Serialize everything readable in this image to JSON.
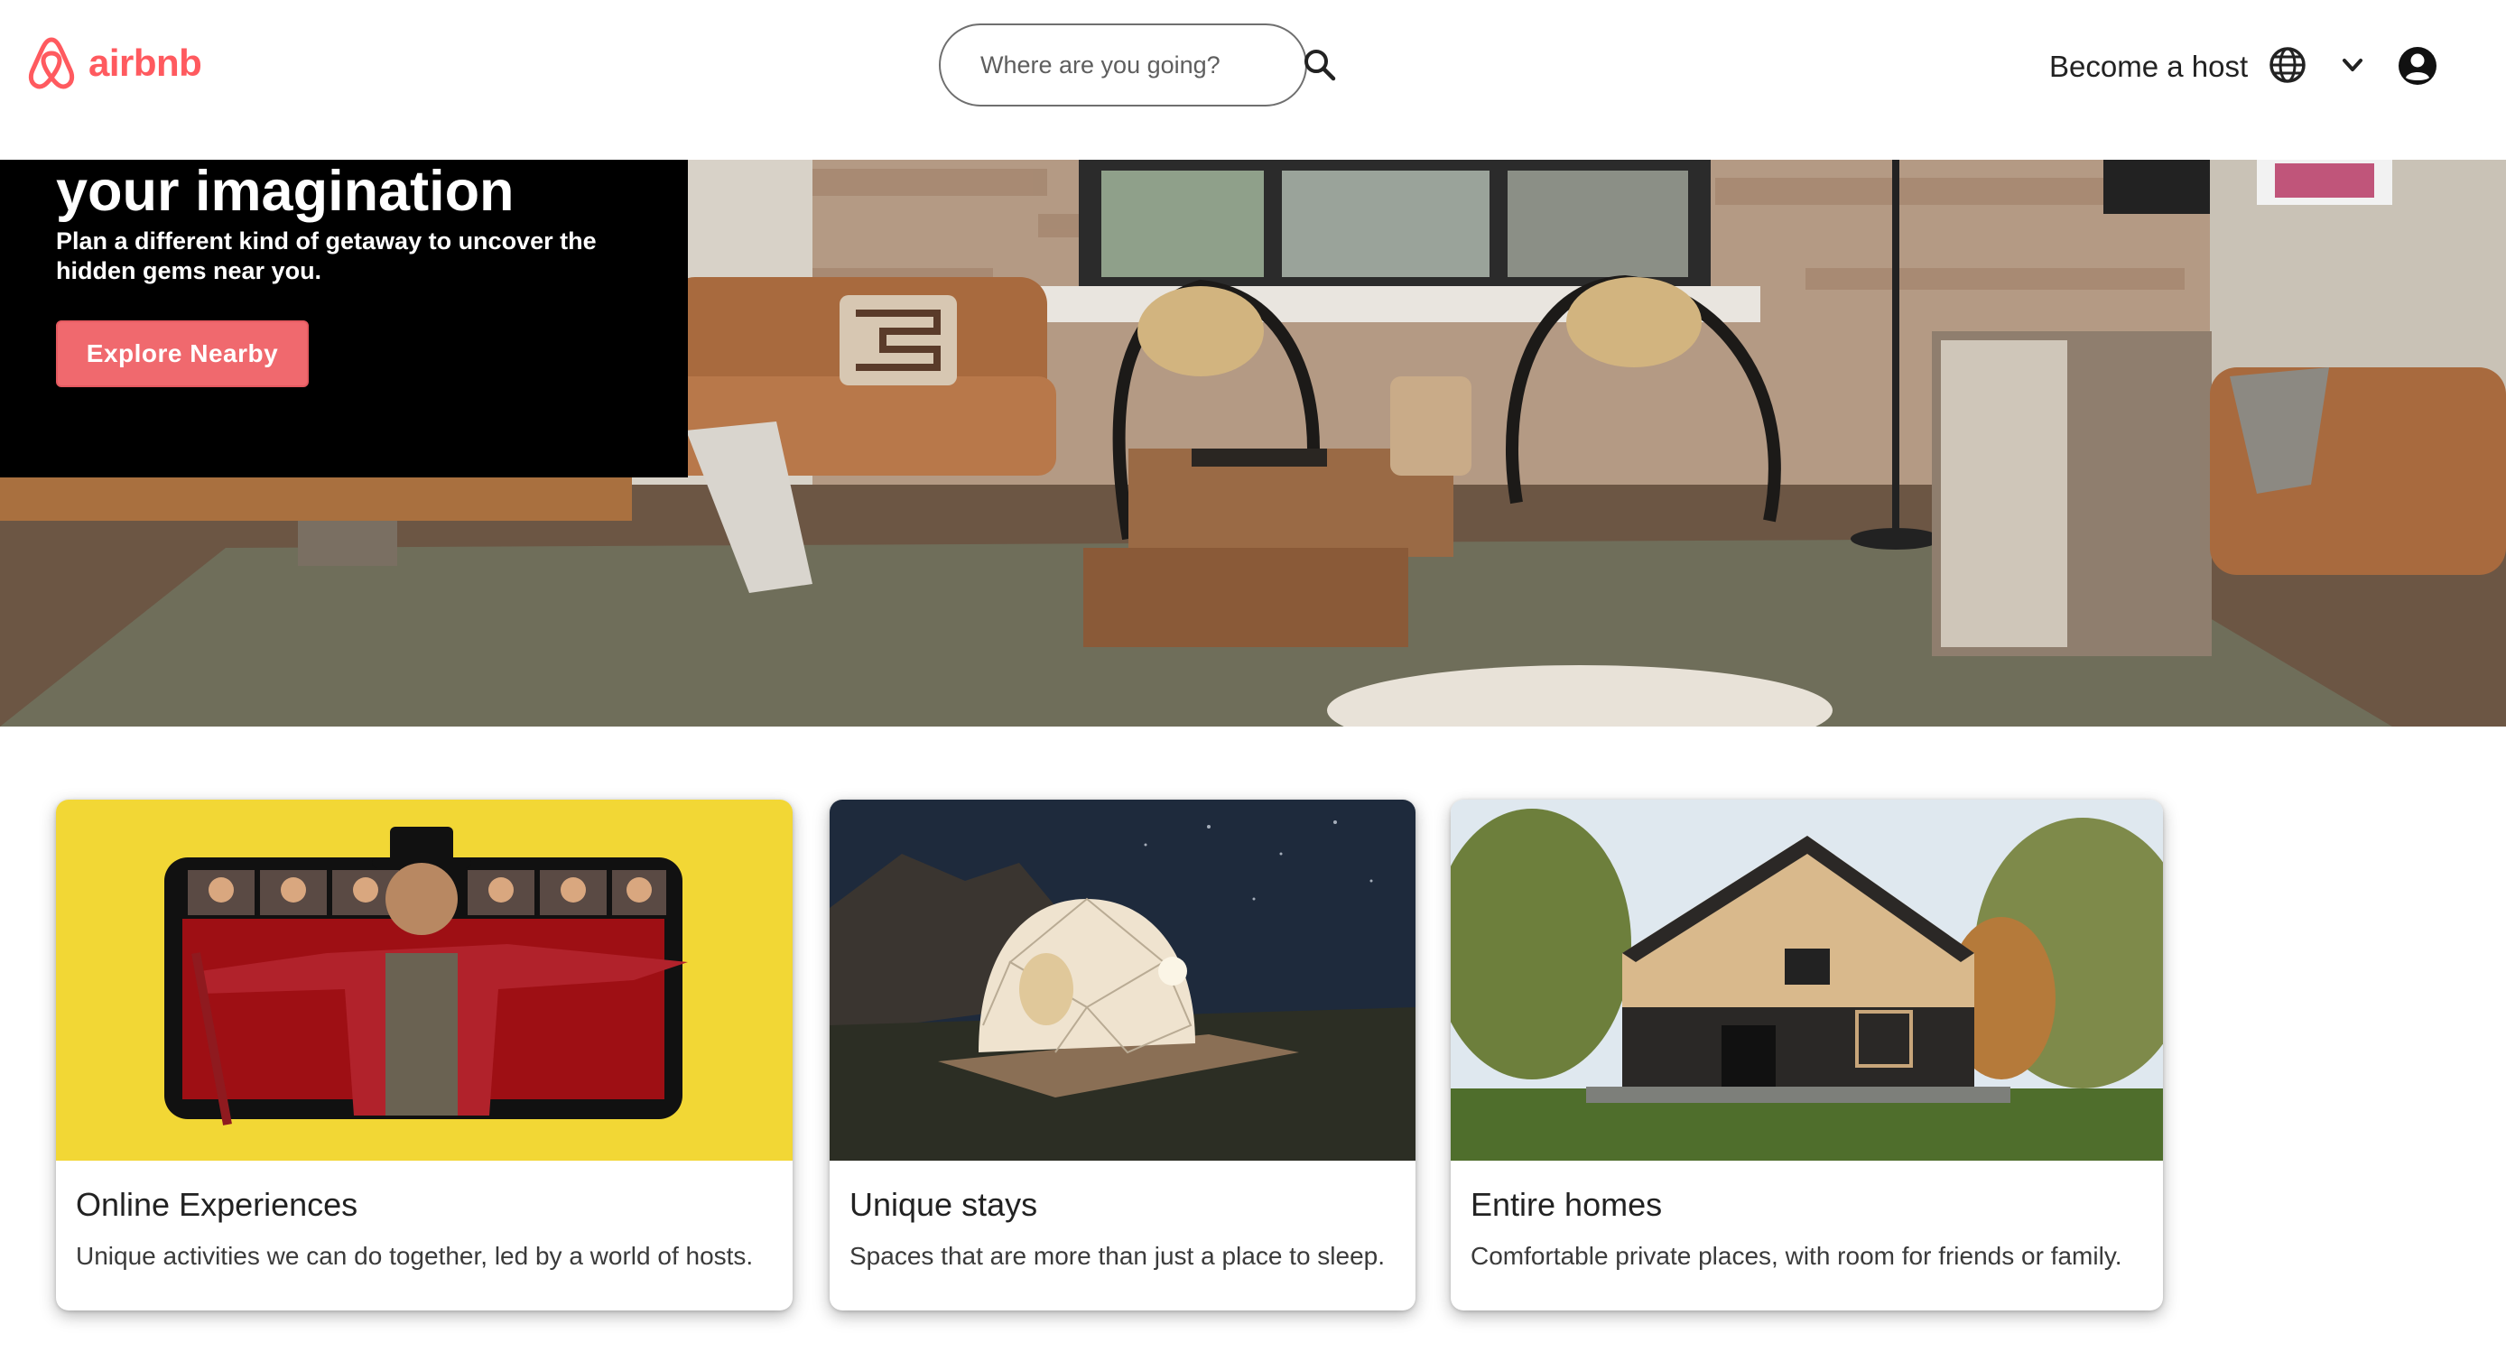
{
  "brand": {
    "name": "airbnb",
    "color": "#ff5a5f"
  },
  "search": {
    "placeholder": "Where are you going?",
    "icon": "search-icon"
  },
  "nav": {
    "host_label": "Become a host",
    "icons": [
      "globe-icon",
      "chevron-down-icon",
      "user-avatar-icon"
    ]
  },
  "hero": {
    "title": "your imagination",
    "subtitle": "Plan a different kind of getaway to uncover the hidden gems near you.",
    "button_label": "Explore Nearby",
    "button_color": "#f0696e",
    "image": "living-room-photo"
  },
  "cards": [
    {
      "title": "Online Experiences",
      "description": "Unique activities we can do together, led by a world of hosts.",
      "image": "online-experience-ringmaster-photo"
    },
    {
      "title": "Unique stays",
      "description": "Spaces that are more than just a place to sleep.",
      "image": "geodesic-dome-night-photo"
    },
    {
      "title": "Entire homes",
      "description": "Comfortable private places, with room for friends or family.",
      "image": "modern-cabin-photo"
    }
  ]
}
